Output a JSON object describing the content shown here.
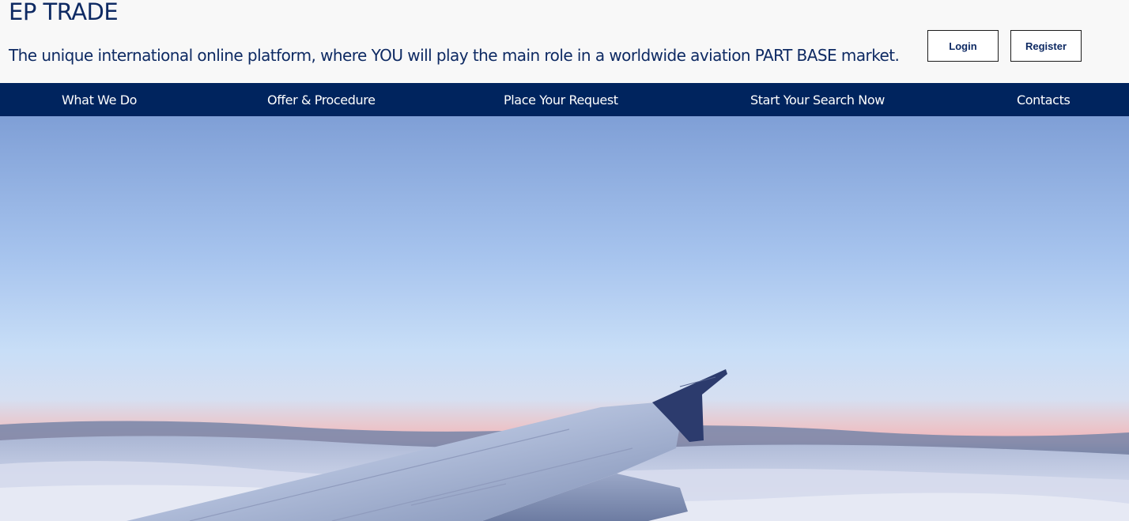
{
  "header": {
    "title": "EP TRADE",
    "tagline": "The unique international online platform, where YOU will play the main role in a worldwide aviation PART BASE market.",
    "login_label": "Login",
    "register_label": "Register"
  },
  "nav": {
    "items": [
      {
        "label": "What We Do"
      },
      {
        "label": "Offer & Procedure"
      },
      {
        "label": "Place Your Request"
      },
      {
        "label": "Start Your Search Now"
      },
      {
        "label": "Contacts"
      }
    ]
  },
  "colors": {
    "brand": "#0e2a63",
    "nav_bg": "#00245e"
  }
}
